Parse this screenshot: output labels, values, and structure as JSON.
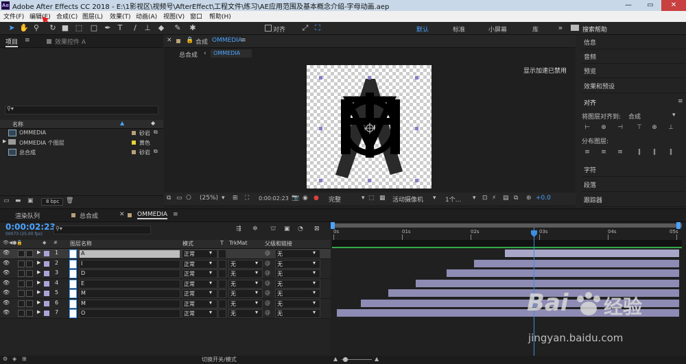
{
  "window": {
    "app_icon": "Ae",
    "title": "Adobe After Effects CC 2018 - E:\\1影视区\\视频号\\AfterEffect\\工程文件\\练习\\AE应用范围及基本概念介绍-字母动画.aep",
    "controls": [
      "—",
      "▭",
      "✕"
    ]
  },
  "menu": [
    "文件(F)",
    "编辑(E)",
    "合成(C)",
    "图层(L)",
    "效果(T)",
    "动画(A)",
    "视图(V)",
    "窗口",
    "帮助(H)"
  ],
  "toolbar": {
    "align_label": "对齐",
    "workspaces": [
      "默认",
      "标准",
      "小屏幕",
      "库"
    ],
    "search_placeholder": "搜索帮助"
  },
  "project": {
    "tab_project": "项目",
    "tab_effects": "效果控件 A",
    "col_name": "名称",
    "items": [
      {
        "name": "OMMEDIA",
        "label": "砂岩",
        "color": "#b8a07a",
        "type": "comp"
      },
      {
        "name": "OMMEDIA 个图层",
        "label": "黄色",
        "color": "#e5d235",
        "type": "folder"
      },
      {
        "name": "总合成",
        "label": "砂岩",
        "color": "#b8a07a",
        "type": "comp"
      }
    ],
    "bpc": "8 bpc"
  },
  "comp_viewer": {
    "tab": "合成",
    "tab_name": "OMMEDIA",
    "breadcrumb_parent": "总合成",
    "breadcrumb_current": "OMMEDIA",
    "accel_msg": "显示加速已禁用",
    "zoom": "(25%)",
    "timecode": "0:00:02:23",
    "quality": "完整",
    "camera": "活动摄像机",
    "views": "1个...",
    "exposure": "+0.0"
  },
  "right_panel": {
    "items": [
      "信息",
      "音频",
      "预览",
      "效果和预设",
      "对齐"
    ],
    "align_to_label": "将图层对齐到:",
    "align_to_value": "合成",
    "distribute_label": "分布图层:",
    "items_bottom": [
      "字符",
      "段落",
      "跟踪器"
    ]
  },
  "timeline": {
    "tabs": [
      "渲染队列",
      "总合成",
      "OMMEDIA"
    ],
    "current_time": "0:00:02:23",
    "frame_info": "00073 (25.00 fps)",
    "cols": {
      "layer_name": "图层名称",
      "mode": "模式",
      "t": "T",
      "trkmat": "TrkMat",
      "parent": "父级和链接"
    },
    "ruler": [
      "0s",
      "01s",
      "02s",
      "03s",
      "04s",
      "05s"
    ],
    "layers": [
      {
        "num": "1",
        "name": "A",
        "mode": "正常",
        "trkmat": "",
        "parent": "无",
        "start": 2.5
      },
      {
        "num": "2",
        "name": "I",
        "mode": "正常",
        "trkmat": "无",
        "parent": "无",
        "start": 2.05
      },
      {
        "num": "3",
        "name": "D",
        "mode": "正常",
        "trkmat": "无",
        "parent": "无",
        "start": 1.65
      },
      {
        "num": "4",
        "name": "E",
        "mode": "正常",
        "trkmat": "无",
        "parent": "无",
        "start": 1.2
      },
      {
        "num": "5",
        "name": "M",
        "mode": "正常",
        "trkmat": "无",
        "parent": "无",
        "start": 0.8
      },
      {
        "num": "6",
        "name": "M",
        "mode": "正常",
        "trkmat": "无",
        "parent": "无",
        "start": 0.4
      },
      {
        "num": "7",
        "name": "O",
        "mode": "正常",
        "trkmat": "无",
        "parent": "无",
        "start": 0.05
      }
    ],
    "switch_label": "切换开关/模式"
  },
  "watermark": {
    "brand": "Bai",
    "brand2": "经验",
    "url": "jingyan.baidu.com"
  }
}
